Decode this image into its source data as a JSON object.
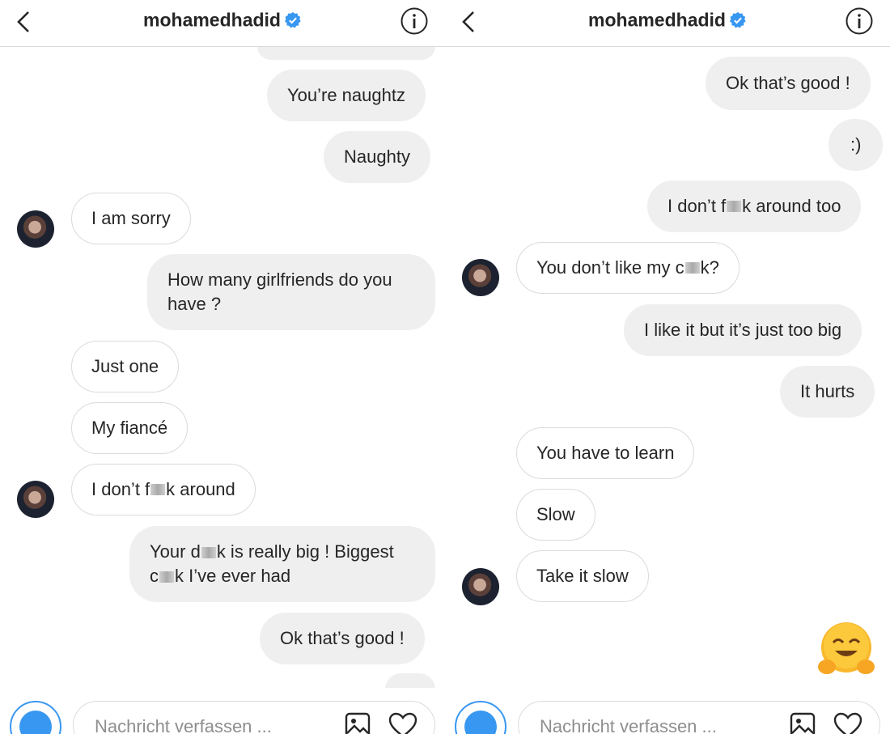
{
  "left": {
    "header": {
      "username": "mohamedhadid"
    },
    "messages": [
      {
        "text": ""
      },
      {
        "text": "You’re naughtz"
      },
      {
        "text": "Naughty"
      },
      {
        "text": "I am sorry"
      },
      {
        "text": "How many girlfriends do you",
        "text2": "have ?"
      },
      {
        "text": "Just one"
      },
      {
        "text": "My fiancé"
      },
      {
        "text_a": "I don’t f",
        "text_b": "k around"
      },
      {
        "text_a": "Your d",
        "text_b": "k is really big ! Biggest",
        "text_c": "c",
        "text_d": "k I’ve ever had"
      },
      {
        "text": "Ok that’s good !"
      },
      {
        "text": ""
      }
    ],
    "composer": {
      "placeholder": "Nachricht verfassen ..."
    }
  },
  "right": {
    "header": {
      "username": "mohamedhadid"
    },
    "messages": [
      {
        "text": "Ok that’s good !"
      },
      {
        "text": ":)"
      },
      {
        "text_a": "I don’t f",
        "text_b": "k around too"
      },
      {
        "text_a": "You don’t like my c",
        "text_b": "k?"
      },
      {
        "text": "I like it but it’s just too big"
      },
      {
        "text": "It hurts"
      },
      {
        "text": "You have to learn"
      },
      {
        "text": "Slow"
      },
      {
        "text": "Take it slow"
      }
    ],
    "composer": {
      "placeholder": "Nachricht verfassen ..."
    }
  },
  "colors": {
    "accent": "#3897f0",
    "outgoing_bubble": "#efefef",
    "incoming_border": "#dbdbdb"
  },
  "icons": [
    "back-chevron-icon",
    "verified-badge-icon",
    "info-icon",
    "camera-icon",
    "gallery-icon",
    "heart-icon",
    "hugging-face-emoji"
  ]
}
